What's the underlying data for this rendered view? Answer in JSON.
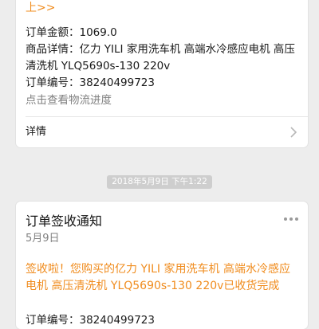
{
  "order_card": {
    "top_link": "上>>",
    "amount_label": "订单金额：",
    "amount_value": "1069.0",
    "detail_label": "商品详情：",
    "detail_value": "亿力 YILI 家用洗车机 高端水冷感应电机 高压清洗机 YLQ5690s-130 220v",
    "number_label": "订单编号：",
    "number_value": "38240499723",
    "track_link": "点击查看物流进度",
    "details_link": "详情",
    "icons": {
      "chevron": "chevron-right-icon"
    }
  },
  "timestamp": "2018年5月9日 下午1:22",
  "receipt_card": {
    "title": "订单签收通知",
    "date": "5月9日",
    "message": "签收啦！您购买的亿力 YILI 家用洗车机 高端水冷感应电机 高压清洗机 YLQ5690s-130 220v已收货完成",
    "number_label": "订单编号：",
    "number_value": "38240499723",
    "icons": {
      "more": "more-dots-icon"
    }
  },
  "colors": {
    "background": "#ededed",
    "card": "#ffffff",
    "accent_orange": "#f08c1e",
    "muted_text": "#808080",
    "timestamp_bg": "#cecece"
  }
}
